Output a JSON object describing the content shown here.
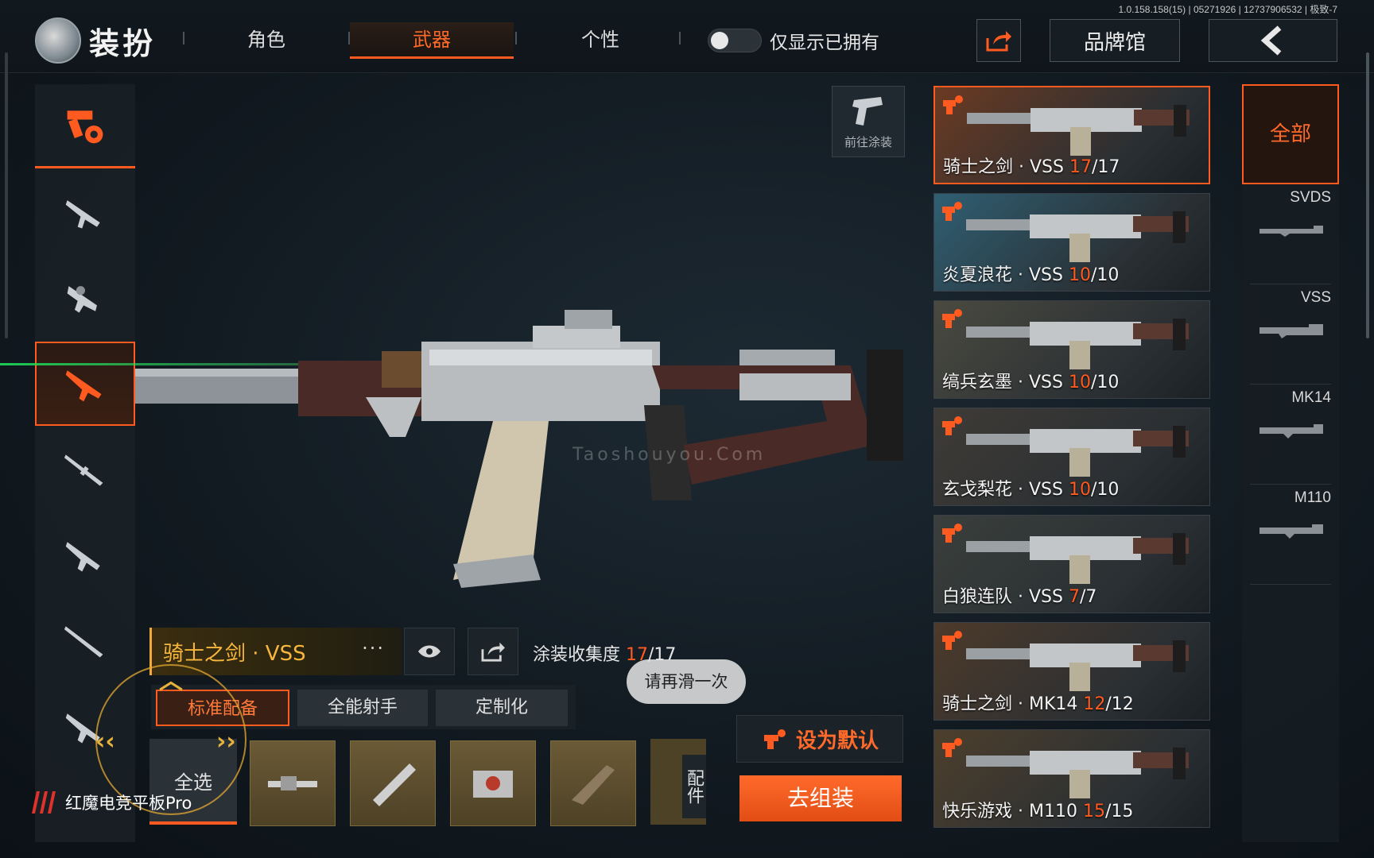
{
  "version": "1.0.158.158(15) | 05271926 | 12737906532 | 极致-7",
  "header": {
    "title": "装扮",
    "tabs": [
      {
        "label": "角色"
      },
      {
        "label": "武器"
      },
      {
        "label": "个性"
      }
    ],
    "toggle_label": "仅显示已拥有",
    "brand_hall": "品牌馆"
  },
  "left_categories": [
    {
      "icon": "paint-spray-icon",
      "selected": false
    },
    {
      "icon": "assault-rifle-icon",
      "selected": false
    },
    {
      "icon": "smg-icon",
      "selected": false
    },
    {
      "icon": "marksman-rifle-icon",
      "selected": true
    },
    {
      "icon": "sniper-rifle-icon",
      "selected": false
    },
    {
      "icon": "rifle-icon",
      "selected": false
    },
    {
      "icon": "bolt-rifle-icon",
      "selected": false
    },
    {
      "icon": "shotgun-icon",
      "selected": false
    }
  ],
  "paint_button": {
    "label": "前往涂装"
  },
  "watermark": "Taoshouyou.Com",
  "weapon_panel": {
    "name": "骑士之剑 · VSS",
    "more": "···",
    "collection_label": "涂装收集度",
    "collection_owned": "17",
    "collection_total": "/17",
    "hint": "请再滑一次",
    "subtabs": [
      {
        "label": "标准配备",
        "active": true
      },
      {
        "label": "全能射手",
        "active": false
      },
      {
        "label": "定制化",
        "active": false
      }
    ],
    "select_all": "全选",
    "parts_cut_label": "配件"
  },
  "brand_watermark": "红魔电竞平板Pro",
  "actions": {
    "set_default": "设为默认",
    "assemble": "去组装"
  },
  "skins": [
    {
      "name": "骑士之剑 · VSS ",
      "owned": "17",
      "total": "/17",
      "selected": true,
      "tint": "#6b3a22"
    },
    {
      "name": "炎夏浪花 · VSS ",
      "owned": "10",
      "total": "/10",
      "selected": false,
      "tint": "#2f5f73"
    },
    {
      "name": "缟兵玄墨 · VSS ",
      "owned": "10",
      "total": "/10",
      "selected": false,
      "tint": "#4a4a40"
    },
    {
      "name": "玄戈梨花 · VSS ",
      "owned": "10",
      "total": "/10",
      "selected": false,
      "tint": "#3f3b36"
    },
    {
      "name": "白狼连队 · VSS ",
      "owned": "7",
      "total": "/7",
      "selected": false,
      "tint": "#3a3f3c"
    },
    {
      "name": "骑士之剑 · MK14 ",
      "owned": "12",
      "total": "/12",
      "selected": false,
      "tint": "#4d3a2a"
    },
    {
      "name": "快乐游戏 · M110 ",
      "owned": "15",
      "total": "/15",
      "selected": false,
      "tint": "#4d3f2c"
    }
  ],
  "right_categories": [
    {
      "label": "全部",
      "active": true
    },
    {
      "label": "SVDS"
    },
    {
      "label": "VSS"
    },
    {
      "label": "MK14"
    },
    {
      "label": "M110"
    }
  ],
  "colors": {
    "accent": "#ff5a1f",
    "gold": "#f7b73c"
  }
}
